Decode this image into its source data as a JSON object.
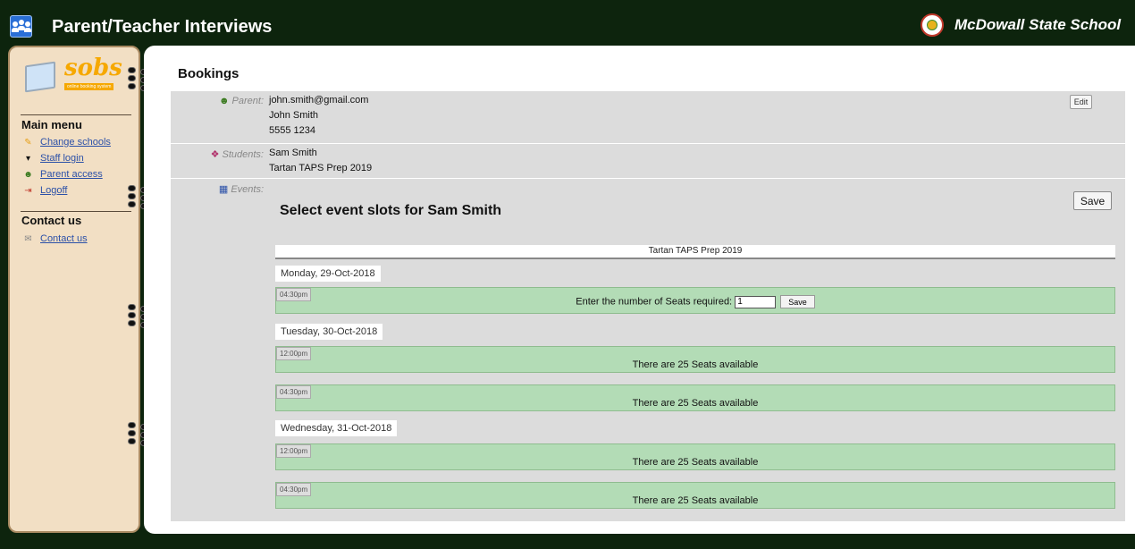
{
  "header": {
    "title": "Parent/Teacher Interviews",
    "school_name": "McDowall State School"
  },
  "sidebar": {
    "logo_text": "sobs",
    "logo_tagline": "online booking system",
    "main_menu_heading": "Main menu",
    "main_menu_items": [
      {
        "label": "Change schools",
        "icon": "pencil-icon"
      },
      {
        "label": "Staff login",
        "icon": "staff-icon"
      },
      {
        "label": "Parent access",
        "icon": "parent-icon"
      },
      {
        "label": "Logoff",
        "icon": "logoff-icon"
      }
    ],
    "contact_heading": "Contact us",
    "contact_items": [
      {
        "label": "Contact us",
        "icon": "envelope-icon"
      }
    ]
  },
  "main": {
    "page_title": "Bookings",
    "parent": {
      "label": "Parent:",
      "email": "john.smith@gmail.com",
      "name": "John Smith",
      "phone": "5555 1234",
      "edit_label": "Edit"
    },
    "students": {
      "label": "Students:",
      "name": "Sam Smith",
      "event": "Tartan TAPS Prep 2019"
    },
    "events": {
      "label": "Events:",
      "save_label": "Save",
      "title": "Select event slots for Sam Smith",
      "event_name": "Tartan TAPS Prep 2019",
      "days": [
        {
          "date": "Monday, 29-Oct-2018",
          "slots": [
            {
              "time": "04:30pm",
              "form": true,
              "prompt": "Enter the number of Seats required:",
              "value": "1",
              "save_label": "Save"
            }
          ]
        },
        {
          "date": "Tuesday, 30-Oct-2018",
          "slots": [
            {
              "time": "12:00pm",
              "text": "There are 25 Seats available"
            },
            {
              "time": "04:30pm",
              "text": "There are 25 Seats available"
            }
          ]
        },
        {
          "date": "Wednesday, 31-Oct-2018",
          "slots": [
            {
              "time": "12:00pm",
              "text": "There are 25 Seats available"
            },
            {
              "time": "04:30pm",
              "text": "There are 25 Seats available"
            }
          ]
        }
      ]
    }
  }
}
